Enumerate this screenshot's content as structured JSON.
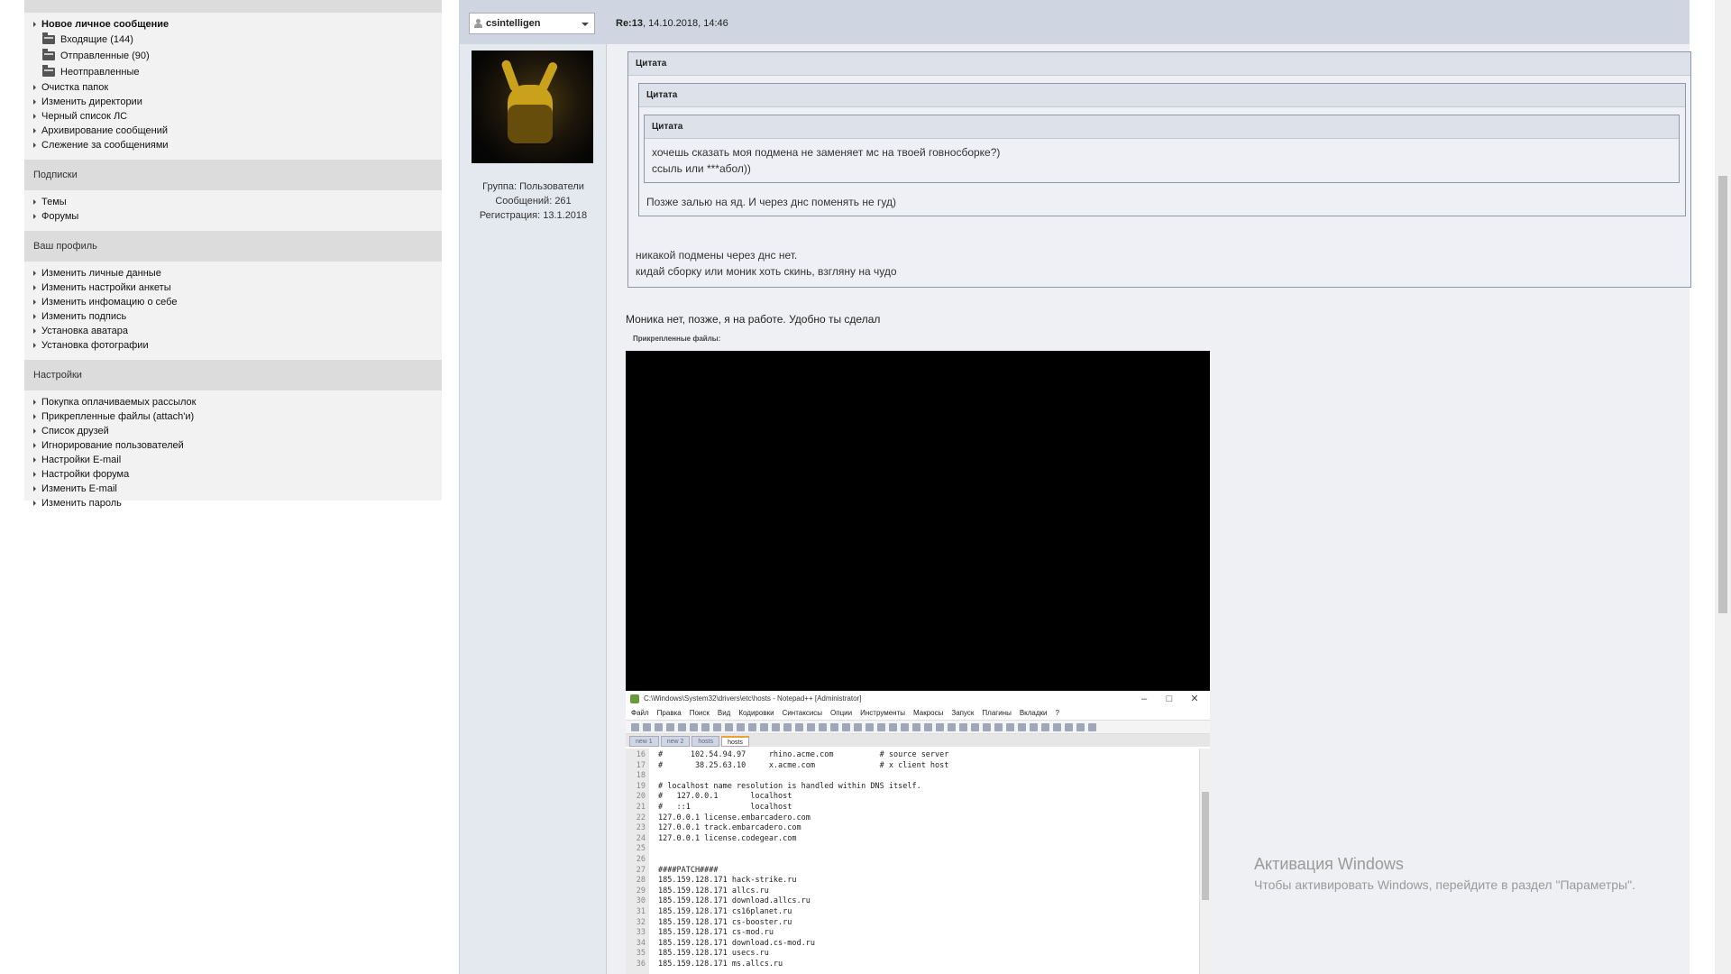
{
  "sidebar": {
    "messages": {
      "items": [
        {
          "label": "Новое личное сообщение"
        },
        {
          "label": "Входящие (144)"
        },
        {
          "label": "Отправленные (90)"
        },
        {
          "label": "Неотправленные"
        },
        {
          "label": "Очистка папок"
        },
        {
          "label": "Изменить директории"
        },
        {
          "label": "Черный список ЛС"
        },
        {
          "label": "Архивирование сообщений"
        },
        {
          "label": "Слежение за сообщениями"
        }
      ]
    },
    "subscriptions": {
      "title": "Подписки",
      "items": [
        {
          "label": "Темы"
        },
        {
          "label": "Форумы"
        }
      ]
    },
    "profile": {
      "title": "Ваш профиль",
      "items": [
        {
          "label": "Изменить личные данные"
        },
        {
          "label": "Изменить настройки анкеты"
        },
        {
          "label": "Изменить инфомацию о себе"
        },
        {
          "label": "Изменить подпись"
        },
        {
          "label": "Установка аватара"
        },
        {
          "label": "Установка фотографии"
        }
      ]
    },
    "settings": {
      "title": "Настройки",
      "items": [
        {
          "label": "Покупка оплачиваемых рассылок"
        },
        {
          "label": "Прикрепленные файлы (attach'и)"
        },
        {
          "label": "Список друзей"
        },
        {
          "label": "Игнорирование пользователей"
        },
        {
          "label": "Настройки E-mail"
        },
        {
          "label": "Настройки форума"
        },
        {
          "label": "Изменить E-mail"
        },
        {
          "label": "Изменить пароль"
        }
      ]
    }
  },
  "post": {
    "username": "csintelligen",
    "meta_prefix": "Re:13",
    "meta_date": ", 14.10.2018, 14:46",
    "author": {
      "group": "Группа: Пользователи",
      "messages": "Сообщений: 261",
      "registered": "Регистрация: 13.1.2018"
    },
    "quote_label": "Цитата",
    "quote_inner_text_1": "хочешь сказать моя подмена не заменяет мс на твоей говносборке?)",
    "quote_inner_text_2": "ссыль или ***абол))",
    "quote_mid_text": "Позже залью на яд. И через днс поменять не гуд)",
    "quote_outer_text_1": "никакой подмены через днс нет.",
    "quote_outer_text_2": "кидай сборку или моник хоть скинь, взгляну на чудо",
    "reply_text": "Моника нет, позже, я на работе. Удобно ты сделал",
    "attachments_label": "Прикрепленные файлы:"
  },
  "notepad": {
    "title": "C:\\Windows\\System32\\drivers\\etc\\hosts - Notepad++ [Administrator]",
    "menu": [
      "Файл",
      "Правка",
      "Поиск",
      "Вид",
      "Кодировки",
      "Синтаксисы",
      "Опции",
      "Инструменты",
      "Макросы",
      "Запуск",
      "Плагины",
      "Вкладки",
      "?"
    ],
    "tabs": [
      "new 1",
      "new 2",
      "hosts",
      "hosts"
    ],
    "line_numbers": [
      "16",
      "17",
      "18",
      "19",
      "20",
      "21",
      "22",
      "23",
      "24",
      "25",
      "26",
      "27",
      "28",
      "29",
      "30",
      "31",
      "32",
      "33",
      "34",
      "35",
      "36"
    ],
    "lines": [
      "#      102.54.94.97     rhino.acme.com          # source server",
      "#       38.25.63.10     x.acme.com              # x client host",
      "",
      "# localhost name resolution is handled within DNS itself.",
      "#   127.0.0.1       localhost",
      "#   ::1             localhost",
      "127.0.0.1 license.embarcadero.com",
      "127.0.0.1 track.embarcadero.com",
      "127.0.0.1 license.codegear.com",
      "",
      "",
      "####PATCH####",
      "185.159.128.171 hack-strike.ru",
      "185.159.128.171 allcs.ru",
      "185.159.128.171 download.allcs.ru",
      "185.159.128.171 cs16planet.ru",
      "185.159.128.171 cs-booster.ru",
      "185.159.128.171 cs-mod.ru",
      "185.159.128.171 download.cs-mod.ru",
      "185.159.128.171 usecs.ru",
      "185.159.128.171 ms.allcs.ru"
    ]
  },
  "watermark": {
    "title": "Активация Windows",
    "subtitle": "Чтобы активировать Windows, перейдите в раздел \"Параметры\"."
  },
  "colors": {
    "post_header": "#cfd6e2",
    "sidebar_bg": "#f2f2f2",
    "section_bg": "#dcdcdc"
  }
}
